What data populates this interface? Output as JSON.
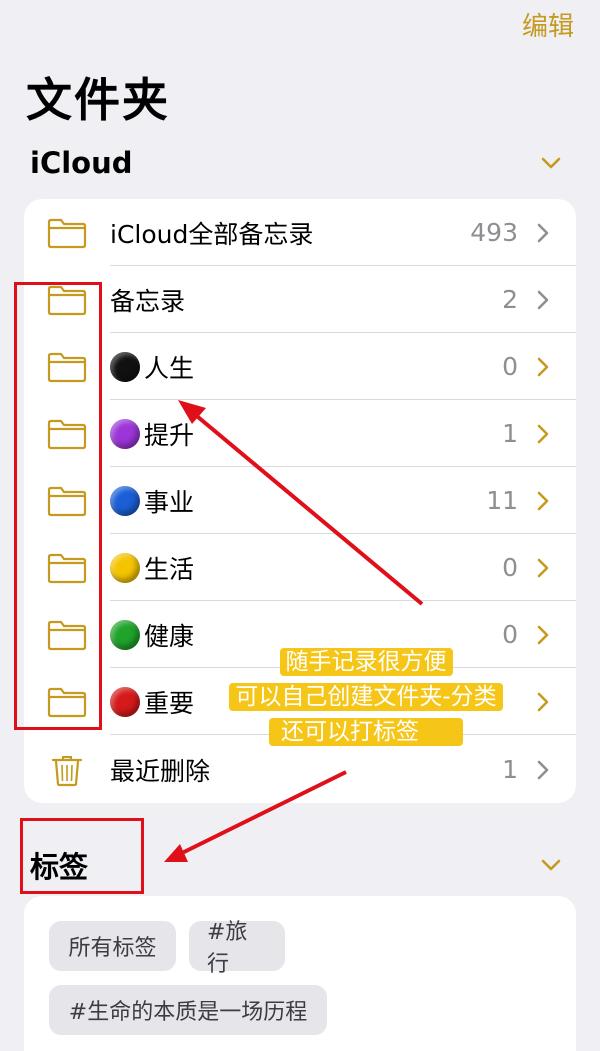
{
  "header": {
    "edit_label": "编辑",
    "title": "文件夹"
  },
  "icloud_section": {
    "title": "iCloud",
    "rows": [
      {
        "label": "iCloud全部备忘录",
        "count": "493",
        "icon": "folder-icon",
        "dot": null
      },
      {
        "label": "备忘录",
        "count": "2",
        "icon": "folder-icon",
        "dot": null
      },
      {
        "label": "人生",
        "count": "0",
        "icon": "folder-icon",
        "dot": "#111111"
      },
      {
        "label": "提升",
        "count": "1",
        "icon": "folder-icon",
        "dot": "#9b35d8"
      },
      {
        "label": "事业",
        "count": "11",
        "icon": "folder-icon",
        "dot": "#1a5fd6"
      },
      {
        "label": "生活",
        "count": "0",
        "icon": "folder-icon",
        "dot": "#f5c400"
      },
      {
        "label": "健康",
        "count": "0",
        "icon": "folder-icon",
        "dot": "#1fa32a"
      },
      {
        "label": "重要",
        "count": "",
        "icon": "folder-icon",
        "dot": "#d61a1a"
      },
      {
        "label": "最近删除",
        "count": "1",
        "icon": "trash-icon",
        "dot": null
      }
    ]
  },
  "tags_section": {
    "title": "标签",
    "tags": [
      "所有标签",
      "#旅行",
      "#生命的本质是一场历程"
    ]
  },
  "annotation": {
    "line1": "随手记录很方便",
    "line2": "可以自己创建文件夹-分类",
    "line3": "还可以打标签"
  },
  "colors": {
    "accent": "#c49a1f",
    "background": "#efeff4",
    "annotation_red": "#e0101a",
    "annotation_yellow": "#f5c518"
  }
}
